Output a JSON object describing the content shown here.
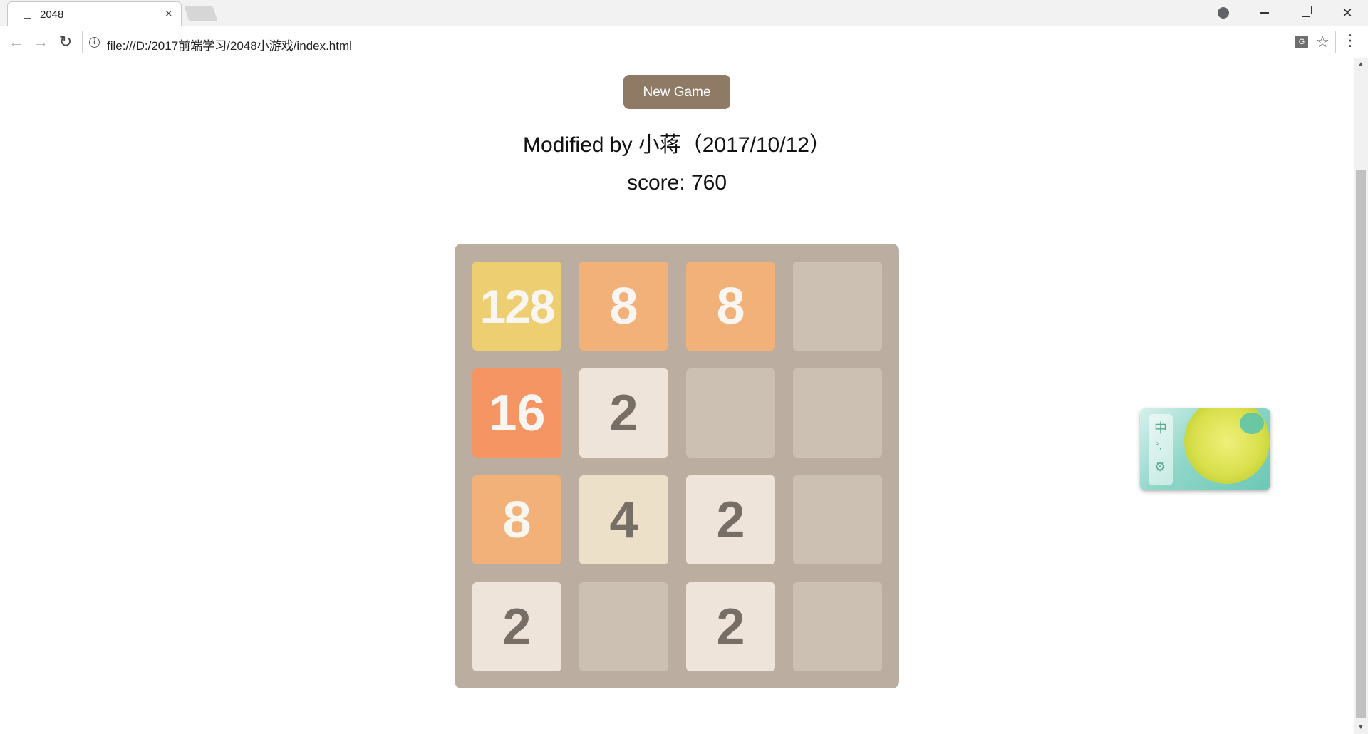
{
  "browser": {
    "tab_title": "2048",
    "tab_close": "×",
    "url": "file:///D:/2017前端学习/2048小游戏/index.html",
    "back": "←",
    "forward": "→",
    "reload": "↻",
    "star": "☆",
    "menu": "⋮",
    "translate": "G",
    "info": "i",
    "window_close": "✕"
  },
  "game": {
    "new_game_label": "New Game",
    "credit": "Modified by 小蒋（2017/10/12）",
    "score_text": "score: 760",
    "board": [
      [
        128,
        8,
        8,
        null
      ],
      [
        16,
        2,
        null,
        null
      ],
      [
        8,
        4,
        2,
        null
      ],
      [
        2,
        null,
        2,
        null
      ]
    ],
    "tile_colors": {
      "2": {
        "bg": "#eee4da",
        "fg": "#776e65"
      },
      "4": {
        "bg": "#ede0c8",
        "fg": "#776e65"
      },
      "8": {
        "bg": "#f2b179",
        "fg": "#f9f6f2"
      },
      "16": {
        "bg": "#f59563",
        "fg": "#f9f6f2"
      },
      "128": {
        "bg": "#edcf72",
        "fg": "#f9f6f2"
      },
      "empty": {
        "bg": "#ccc0b3",
        "fg": "#776e65"
      }
    }
  },
  "ime": {
    "lang": "中",
    "punct": "°,",
    "gear": "⚙"
  }
}
